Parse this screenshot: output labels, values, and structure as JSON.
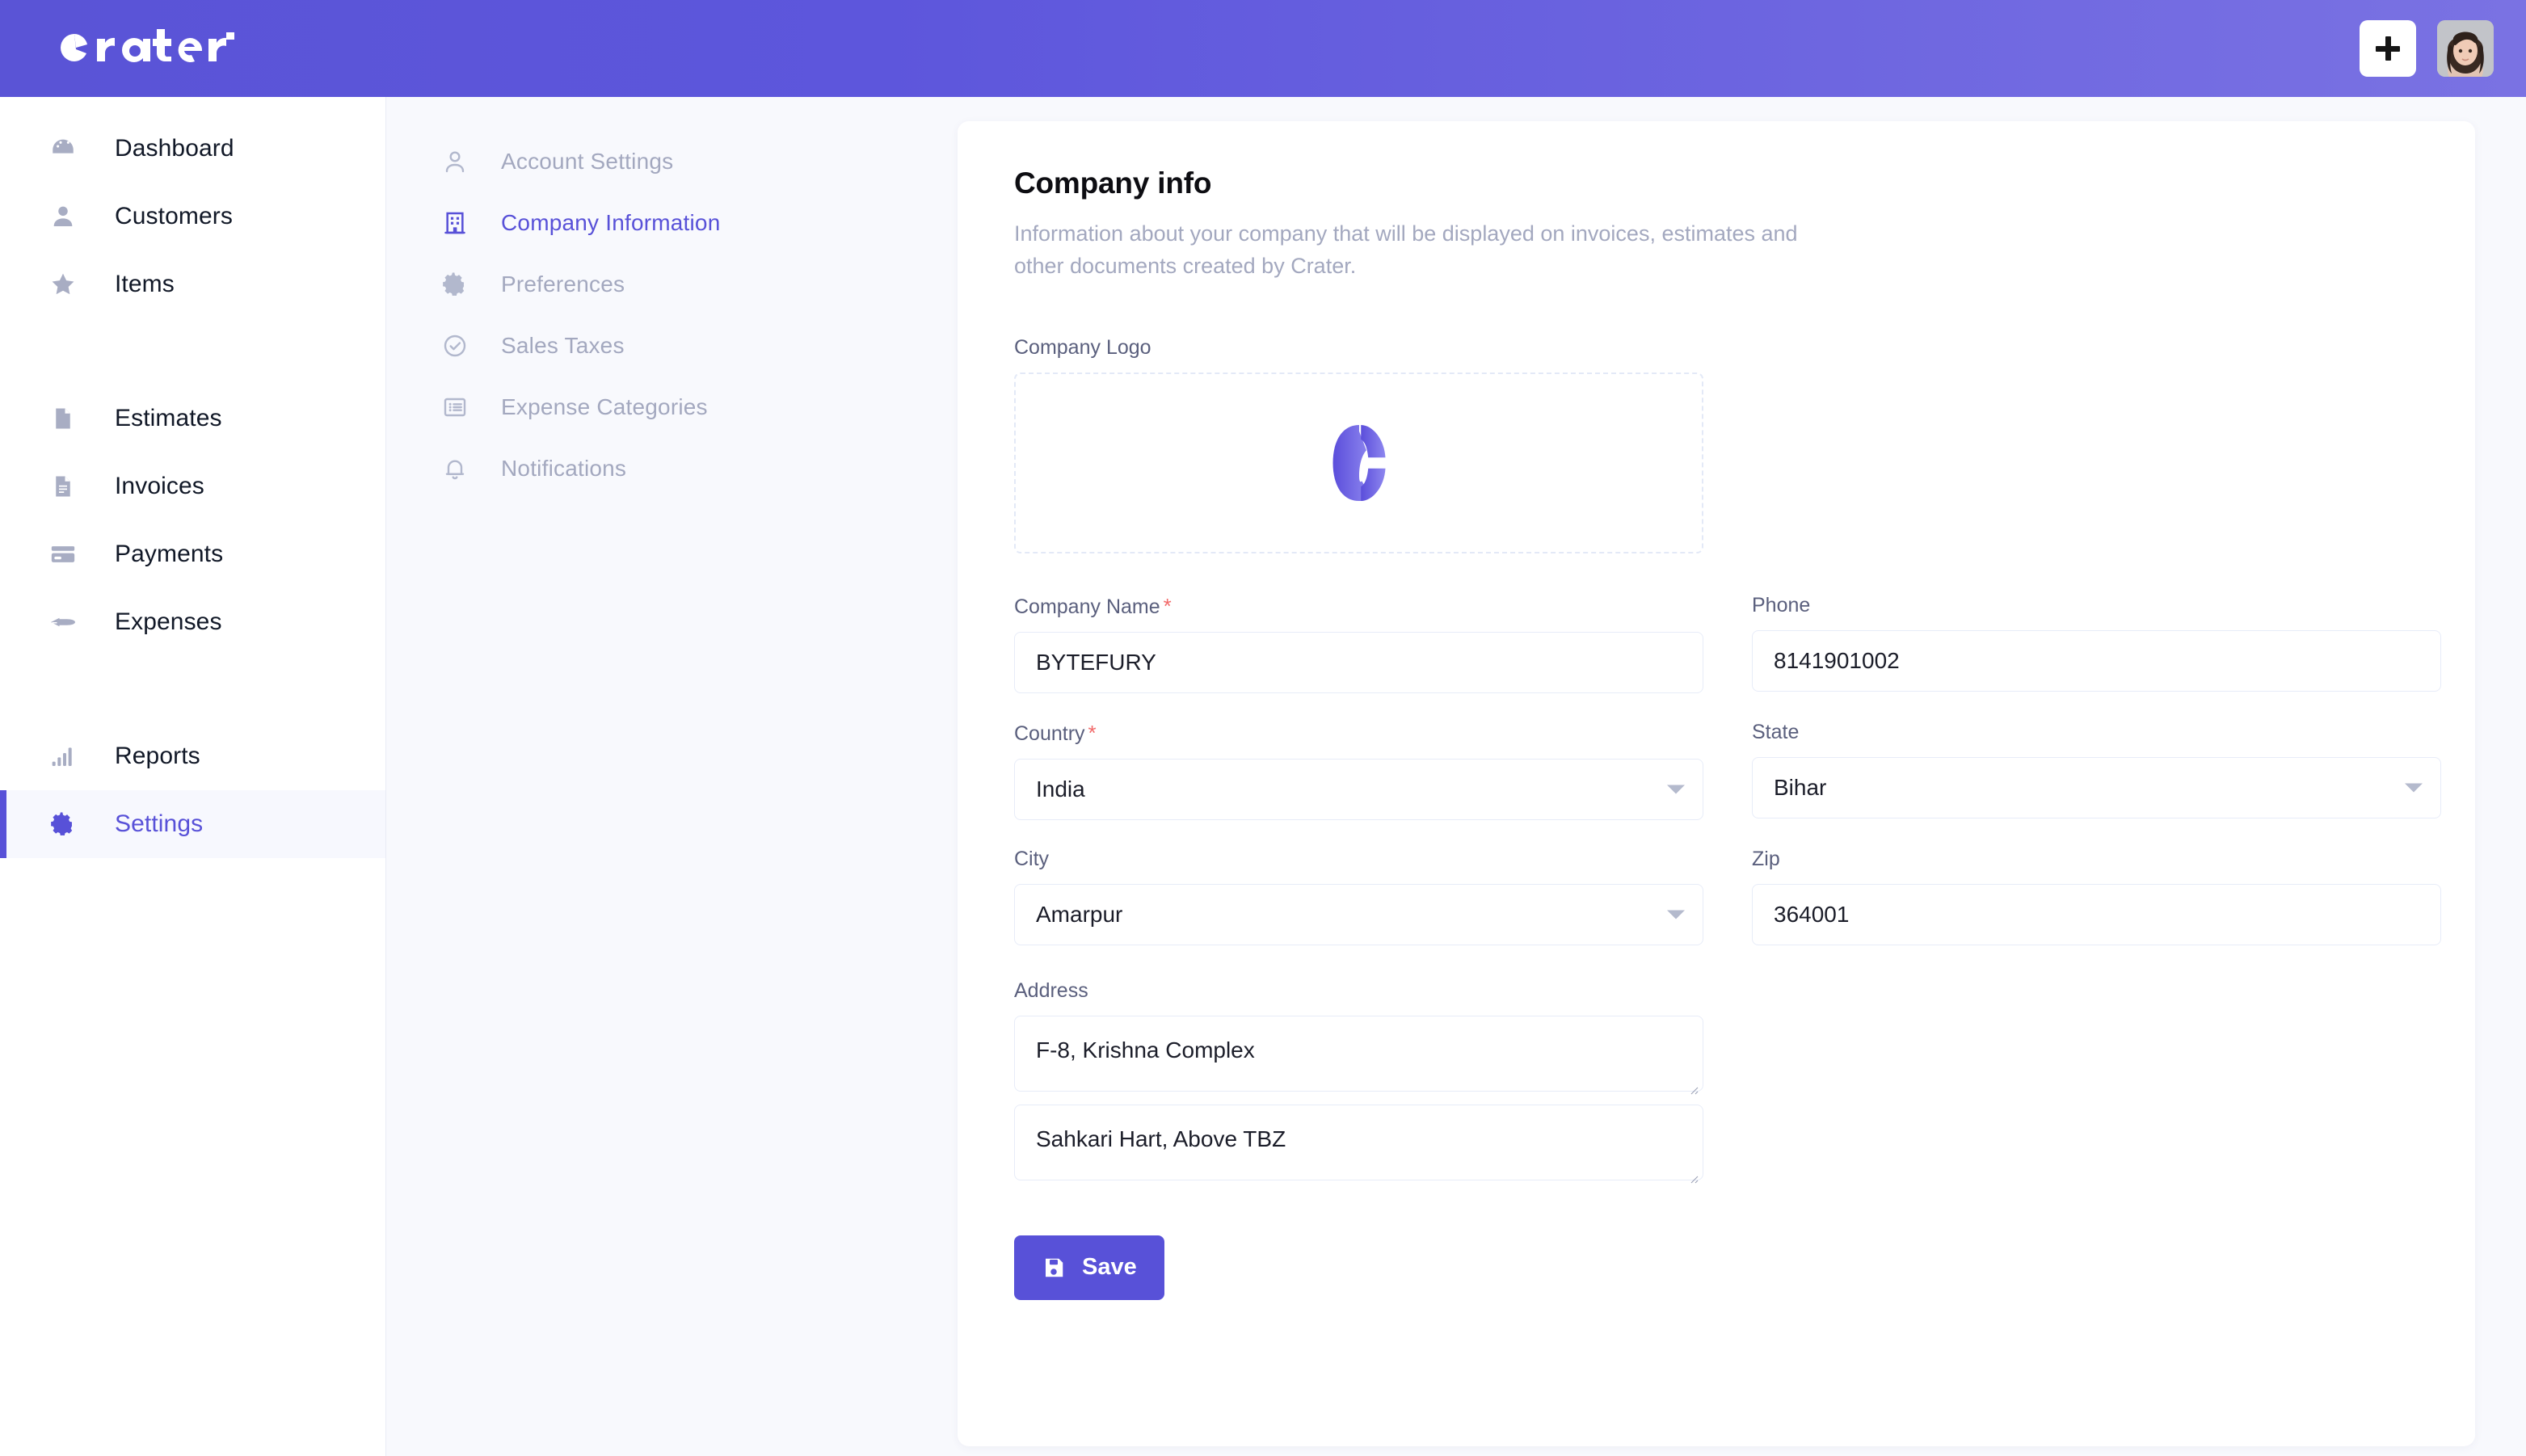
{
  "app": {
    "brand_name": "crater",
    "accent_color": "#5851d8",
    "header_gradient_from": "#5a54d6",
    "header_gradient_to": "#7a72e3"
  },
  "header": {
    "add_button_icon": "plus-icon",
    "avatar_icon": "user-avatar"
  },
  "sidebar": {
    "groups": [
      {
        "items": [
          {
            "label": "Dashboard",
            "icon": "gauge-icon",
            "active": false
          },
          {
            "label": "Customers",
            "icon": "person-icon",
            "active": false
          },
          {
            "label": "Items",
            "icon": "star-icon",
            "active": false
          }
        ]
      },
      {
        "items": [
          {
            "label": "Estimates",
            "icon": "document-icon",
            "active": false
          },
          {
            "label": "Invoices",
            "icon": "invoice-icon",
            "active": false
          },
          {
            "label": "Payments",
            "icon": "credit-card-icon",
            "active": false
          },
          {
            "label": "Expenses",
            "icon": "rocket-icon",
            "active": false
          }
        ]
      },
      {
        "items": [
          {
            "label": "Reports",
            "icon": "bar-chart-icon",
            "active": false
          },
          {
            "label": "Settings",
            "icon": "gear-icon",
            "active": true
          }
        ]
      }
    ]
  },
  "subnav": {
    "items": [
      {
        "label": "Account Settings",
        "icon": "user-outline-icon",
        "active": false
      },
      {
        "label": "Company Information",
        "icon": "building-icon",
        "active": true
      },
      {
        "label": "Preferences",
        "icon": "gear-icon",
        "active": false
      },
      {
        "label": "Sales Taxes",
        "icon": "check-circle-icon",
        "active": false
      },
      {
        "label": "Expense Categories",
        "icon": "list-icon",
        "active": false
      },
      {
        "label": "Notifications",
        "icon": "bell-icon",
        "active": false
      }
    ]
  },
  "main": {
    "title": "Company info",
    "description": "Information about your company that will be displayed on invoices, estimates and other documents created by Crater.",
    "logo": {
      "label": "Company Logo",
      "icon": "crater-logo-mark"
    },
    "fields": {
      "company_name": {
        "label": "Company Name",
        "required": true,
        "value": "BYTEFURY"
      },
      "phone": {
        "label": "Phone",
        "required": false,
        "value": "8141901002"
      },
      "country": {
        "label": "Country",
        "required": true,
        "value": "India",
        "type": "select"
      },
      "state": {
        "label": "State",
        "required": false,
        "value": "Bihar",
        "type": "select"
      },
      "city": {
        "label": "City",
        "required": false,
        "value": "Amarpur",
        "type": "select"
      },
      "zip": {
        "label": "Zip",
        "required": false,
        "value": "364001"
      },
      "address": {
        "label": "Address",
        "line1": "F-8, Krishna Complex",
        "line2": "Sahkari Hart, Above TBZ"
      }
    },
    "save_button": {
      "label": "Save",
      "icon": "save-disk-icon"
    }
  }
}
